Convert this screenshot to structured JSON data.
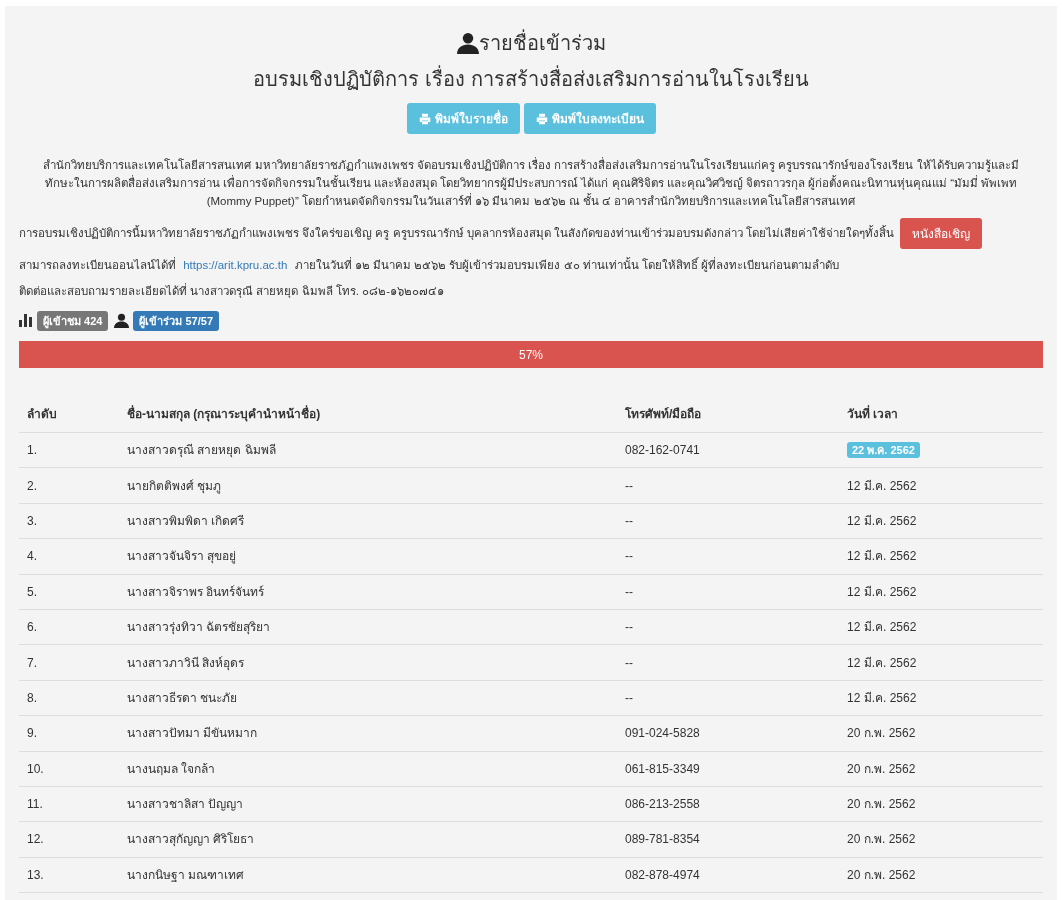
{
  "header": {
    "title": "รายชื่อเข้าร่วม",
    "subtitle": "อบรมเชิงปฏิบัติการ เรื่อง การสร้างสื่อส่งเสริมการอ่านในโรงเรียน"
  },
  "buttons": [
    "พิมพ์ใบรายชื่อ",
    "พิมพ์ใบลงทะเบียน"
  ],
  "intro": "สำนักวิทยบริการและเทคโนโลยีสารสนเทศ มหาวิทยาลัยราชภัฏกำแพงเพชร  จัดอบรมเชิงปฏิบัติการ เรื่อง การสร้างสื่อส่งเสริมการอ่านในโรงเรียนแก่ครู ครูบรรณารักษ์ของโรงเรียน ให้ได้รับความรู้และมีทักษะในการผลิตสื่อส่งเสริมการอ่าน เพื่อการจัดกิจกรรมในชั้นเรียน และห้องสมุด โดยวิทยากรผู้มีประสบการณ์ ได้แก่ คุณศิริจิตร และคุณวิศวิชญ์ จิตรถาวรกุล ผู้ก่อตั้งคณะนิทานหุ่นคุณแม่ “มัมมี่ พัพเพท (Mommy Puppet)” โดยกำหนดจัดกิจกรรมในวันเสาร์ที่ ๑๖ มีนาคม ๒๕๖๒  ณ  ชั้น ๔  อาคารสำนักวิทยบริการและเทคโนโลยีสารสนเทศ",
  "invite": {
    "text": "การอบรมเชิงปฏิบัติการนี้มหาวิทยาลัยราชภัฏกำแพงเพชร จึงใคร่ขอเชิญ ครู ครูบรรณารักษ์ บุคลากรห้องสมุด ในสังกัดของท่านเข้าร่วมอบรมดังกล่าว โดยไม่เสียค่าใช้จ่ายใดๆทั้งสิ้น",
    "button": "หนังสือเชิญ"
  },
  "register": {
    "before": "สามารถลงทะเบียนออนไลน์ได้ที่",
    "link": "https://arit.kpru.ac.th",
    "after": "ภายในวันที่ ๑๒ มีนาคม ๒๕๖๒ รับผู้เข้าร่วมอบรมเพียง ๕๐ ท่านเท่านั้น โดยให้สิทธิ์ ผู้ที่ลงทะเบียนก่อนตามลำดับ"
  },
  "contact": "ติดต่อและสอบถามรายละเอียดได้ที่ นางสาวดรุณี สายหยุด ฉิมพลี โทร. ๐๘๒-๑๖๒๐๗๔๑",
  "stats": [
    {
      "kind": "views",
      "label": "ผู้เข้าชม 424",
      "color": "#777777"
    },
    {
      "kind": "participants",
      "label": "ผู้เข้าร่วม 57/57",
      "color": "#337ab7"
    }
  ],
  "progress": {
    "level": 1,
    "label": "57%"
  },
  "table": {
    "columns": [
      "ลำดับ",
      "ชื่อ-นามสกุล (กรุณาระบุคำนำหน้าชื่อ)",
      "โทรศัพท์/มือถือ",
      "วันที่ เวลา"
    ],
    "rows": [
      {
        "kind": "badge",
        "no": "1.",
        "name": "นางสาวดรุณี สายหยุด ฉิมพลี",
        "phone": "082-162-0741",
        "date": "22 พ.ค. 2562"
      },
      {
        "kind": "text",
        "no": "2.",
        "name": "นายกิตติพงศ์ ชุมภู",
        "phone": "--",
        "date": "12 มี.ค. 2562"
      },
      {
        "kind": "text",
        "no": "3.",
        "name": "นางสาวพิมพิดา เกิดศรี",
        "phone": "--",
        "date": "12 มี.ค. 2562"
      },
      {
        "kind": "text",
        "no": "4.",
        "name": "นางสาวจันจิรา สุขอยู่",
        "phone": "--",
        "date": "12 มี.ค. 2562"
      },
      {
        "kind": "text",
        "no": "5.",
        "name": "นางสาวจิราพร อินทร์จันทร์",
        "phone": "--",
        "date": "12 มี.ค. 2562"
      },
      {
        "kind": "text",
        "no": "6.",
        "name": "นางสาวรุ่งทิวา ฉัตรชัยสุริยา",
        "phone": "--",
        "date": "12 มี.ค. 2562"
      },
      {
        "kind": "text",
        "no": "7.",
        "name": "นางสาวภาวินี สิงห์อุดร",
        "phone": "--",
        "date": "12 มี.ค. 2562"
      },
      {
        "kind": "text",
        "no": "8.",
        "name": "นางสาวธีรดา ชนะภัย",
        "phone": "--",
        "date": "12 มี.ค. 2562"
      },
      {
        "kind": "text",
        "no": "9.",
        "name": "นางสาวปัทมา มีขันหมาก",
        "phone": "091-024-5828",
        "date": "20 ก.พ. 2562"
      },
      {
        "kind": "text",
        "no": "10.",
        "name": "นางนฤมล ใจกล้า",
        "phone": "061-815-3349",
        "date": "20 ก.พ. 2562"
      },
      {
        "kind": "text",
        "no": "11.",
        "name": "นางสาวชาลิสา ปัญญา",
        "phone": "086-213-2558",
        "date": "20 ก.พ. 2562"
      },
      {
        "kind": "text",
        "no": "12.",
        "name": "นางสาวสุกัญญา ศิริโยธา",
        "phone": "089-781-8354",
        "date": "20 ก.พ. 2562"
      },
      {
        "kind": "text",
        "no": "13.",
        "name": "นางกนิษฐา มณฑาเทศ",
        "phone": "082-878-4974",
        "date": "20 ก.พ. 2562"
      }
    ]
  }
}
